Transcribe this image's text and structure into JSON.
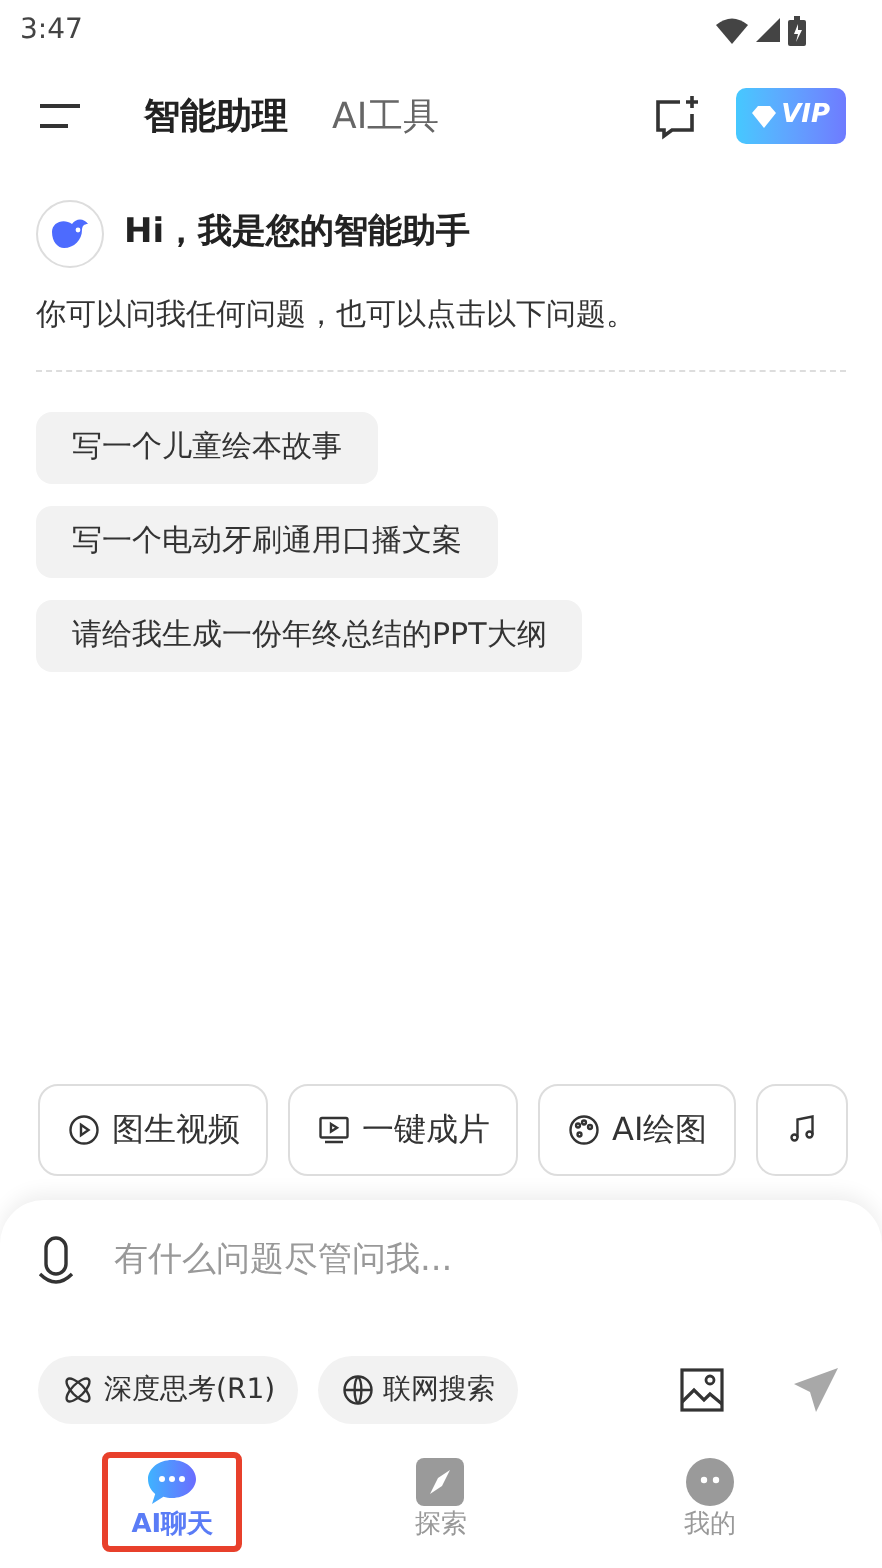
{
  "status_bar": {
    "time": "3:47"
  },
  "header": {
    "tabs": [
      {
        "label": "智能助理",
        "selected": true
      },
      {
        "label": "AI工具",
        "selected": false
      }
    ],
    "vip": "VIP"
  },
  "greeting": {
    "title": "Hi，我是您的智能助手",
    "subtitle": "你可以问我任何问题，也可以点击以下问题。"
  },
  "suggestions": [
    "写一个儿童绘本故事",
    "写一个电动牙刷通用口播文案",
    "请给我生成一份年终总结的PPT大纲"
  ],
  "tools": [
    {
      "kind": "video",
      "label": "图生视频"
    },
    {
      "kind": "clip",
      "label": "一键成片"
    },
    {
      "kind": "paint",
      "label": "AI绘图"
    },
    {
      "kind": "music"
    }
  ],
  "input": {
    "placeholder": "有什么问题尽管问我...",
    "options": [
      {
        "kind": "think",
        "label": "深度思考(R1)",
        "on": false
      },
      {
        "kind": "web",
        "label": "联网搜索",
        "on": false
      }
    ]
  },
  "bottom_nav": [
    {
      "kind": "chat",
      "label": "AI聊天",
      "selected": true,
      "highlighted": true
    },
    {
      "kind": "explore",
      "label": "探索",
      "selected": false,
      "highlighted": false
    },
    {
      "kind": "me",
      "label": "我的",
      "selected": false,
      "highlighted": false
    }
  ]
}
